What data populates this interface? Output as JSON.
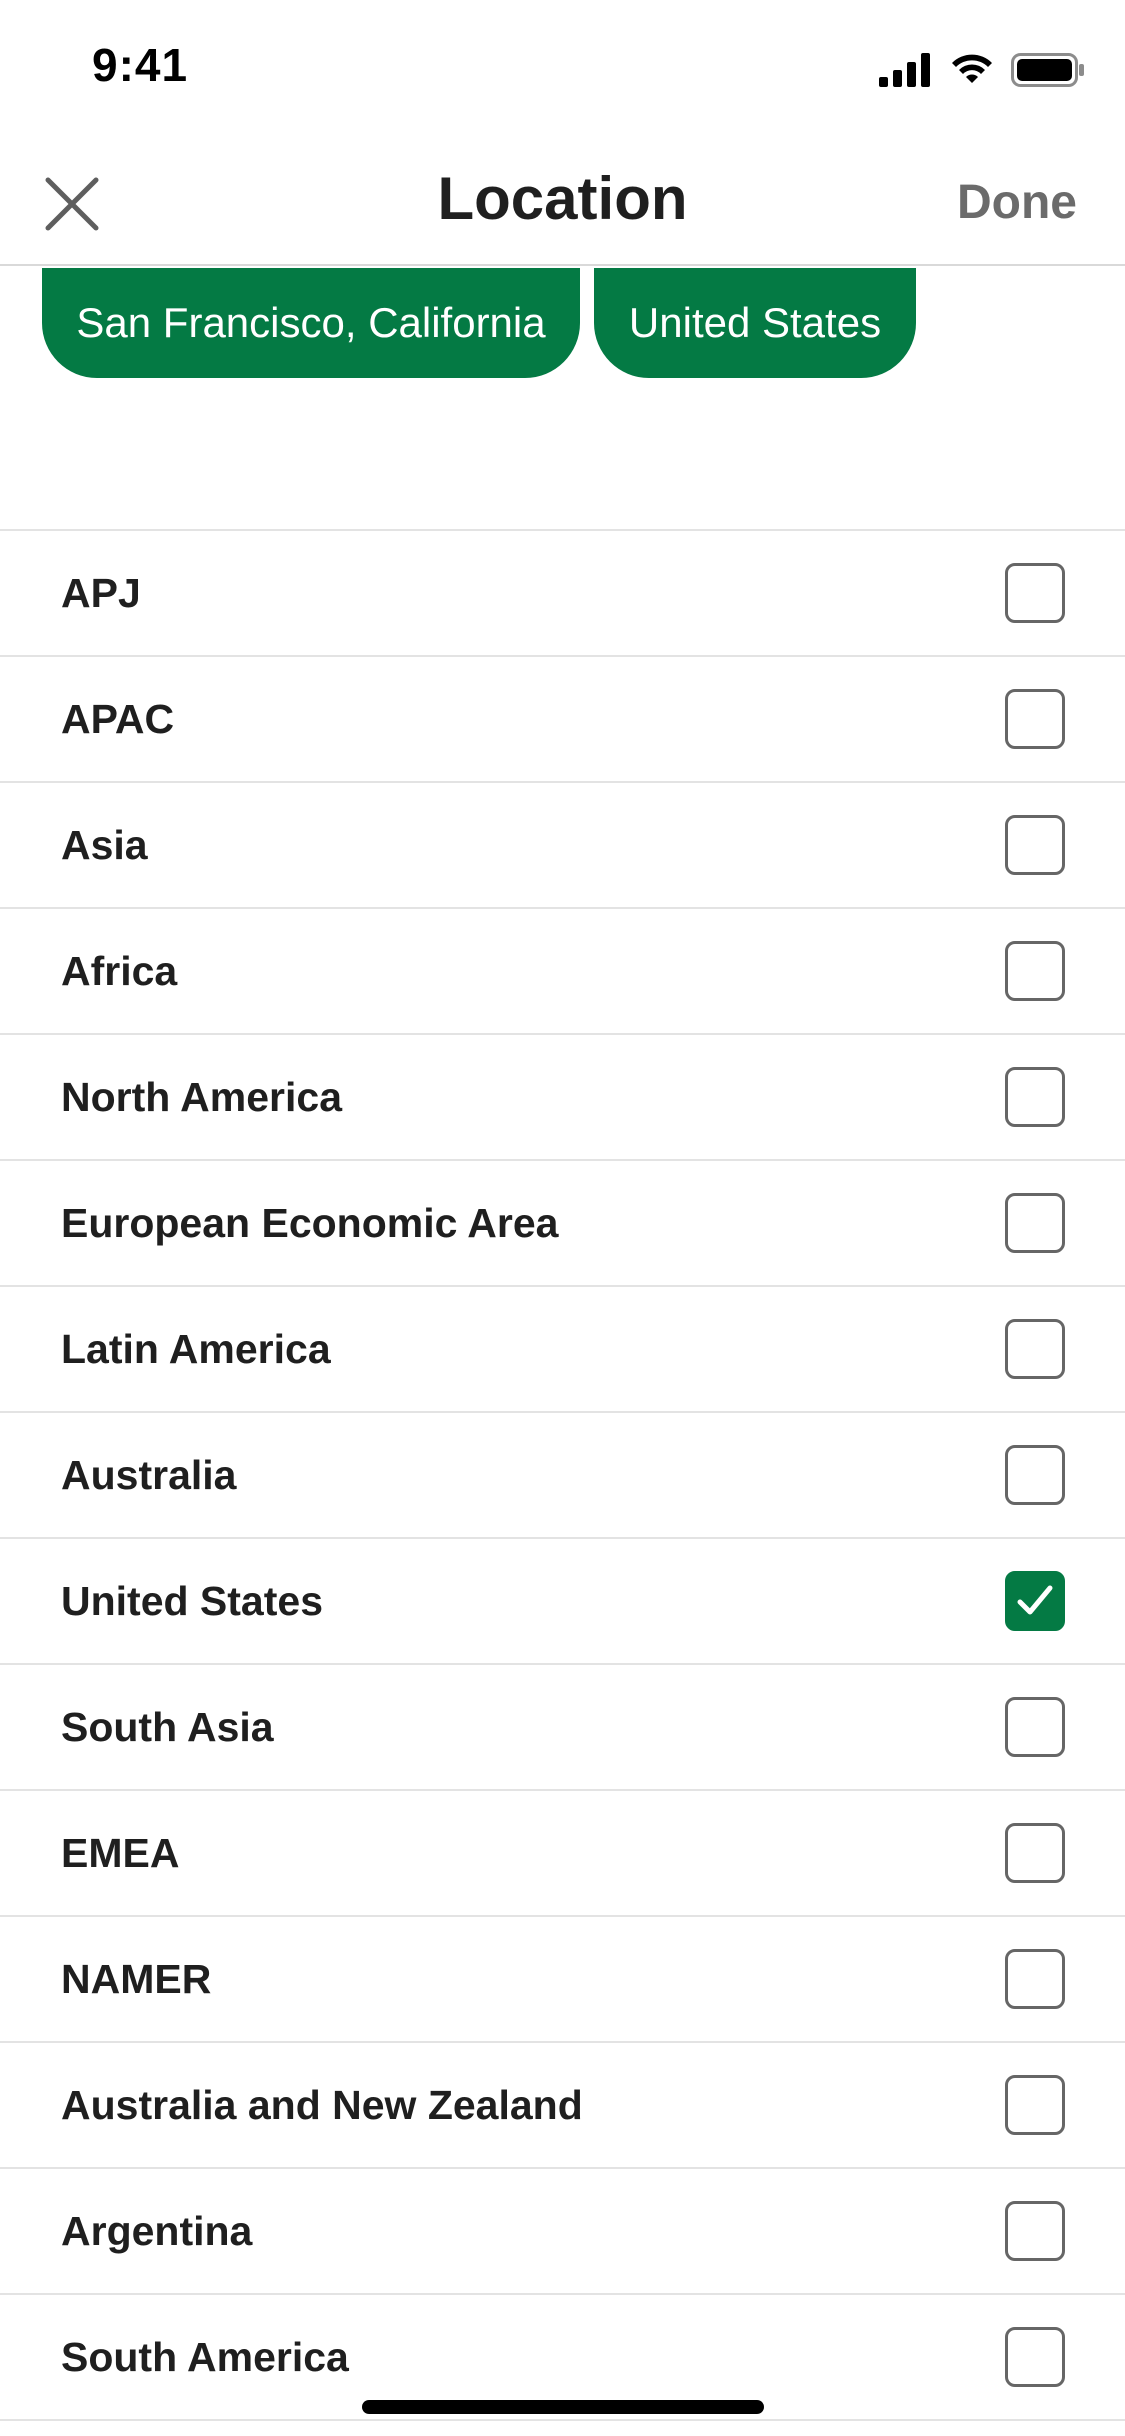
{
  "status_bar": {
    "time": "9:41",
    "icons": [
      "cellular-signal-icon",
      "wifi-icon",
      "battery-icon"
    ]
  },
  "nav": {
    "title": "Location",
    "done_label": "Done",
    "close_icon": "close-icon"
  },
  "chips": [
    {
      "label": "San Francisco, California"
    },
    {
      "label": "United States"
    }
  ],
  "locations": [
    {
      "label": "APJ",
      "checked": false
    },
    {
      "label": "APAC",
      "checked": false
    },
    {
      "label": "Asia",
      "checked": false
    },
    {
      "label": "Africa",
      "checked": false
    },
    {
      "label": "North America",
      "checked": false
    },
    {
      "label": "European Economic Area",
      "checked": false
    },
    {
      "label": "Latin America",
      "checked": false
    },
    {
      "label": "Australia",
      "checked": false
    },
    {
      "label": "United States",
      "checked": true
    },
    {
      "label": "South Asia",
      "checked": false
    },
    {
      "label": "EMEA",
      "checked": false
    },
    {
      "label": "NAMER",
      "checked": false
    },
    {
      "label": "Australia and New Zealand",
      "checked": false
    },
    {
      "label": "Argentina",
      "checked": false
    },
    {
      "label": "South America",
      "checked": false
    }
  ],
  "colors": {
    "accent": "#047a44",
    "title_text": "#1f1f1f",
    "done_text": "#6b6b6b"
  }
}
